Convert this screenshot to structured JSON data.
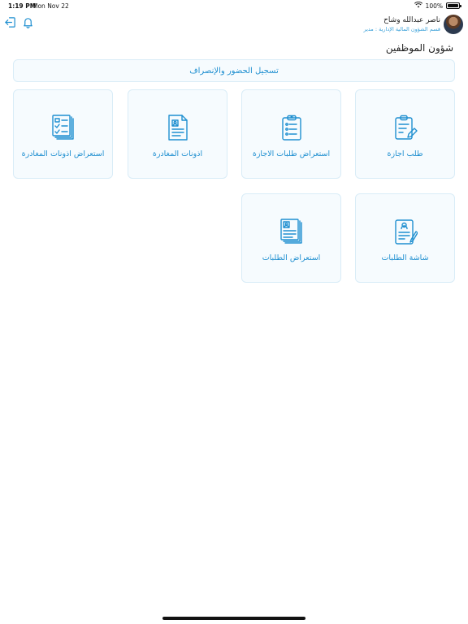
{
  "status_bar": {
    "time": "1:19 PM",
    "date": "Mon Nov 22",
    "battery": "100%"
  },
  "header": {
    "user_name": "ناصر عبدالله وشاح",
    "user_subtitle": "قسم الشؤون المالية الإدارية : مدير",
    "icons": [
      "logout-icon",
      "bell-icon"
    ]
  },
  "page": {
    "title": "شؤون الموظفين"
  },
  "banner": {
    "label": "تسجيل الحضور والإنصراف"
  },
  "cards": [
    {
      "label": "طلب اجازة",
      "icon": "clipboard-edit-icon"
    },
    {
      "label": "استعراض طلبات الاجازة",
      "icon": "clipboard-list-icon"
    },
    {
      "label": "اذونات المغادرة",
      "icon": "document-profile-icon"
    },
    {
      "label": "استعراض اذونات المغادرة",
      "icon": "checklist-stack-icon"
    },
    {
      "label": "شاشة الطلبات",
      "icon": "request-form-icon"
    },
    {
      "label": "استعراض الطلبات",
      "icon": "documents-stack-icon"
    }
  ],
  "colors": {
    "accent": "#1f8fd0",
    "card_bg": "#f6fbfe",
    "card_border": "#d9ecf7"
  }
}
